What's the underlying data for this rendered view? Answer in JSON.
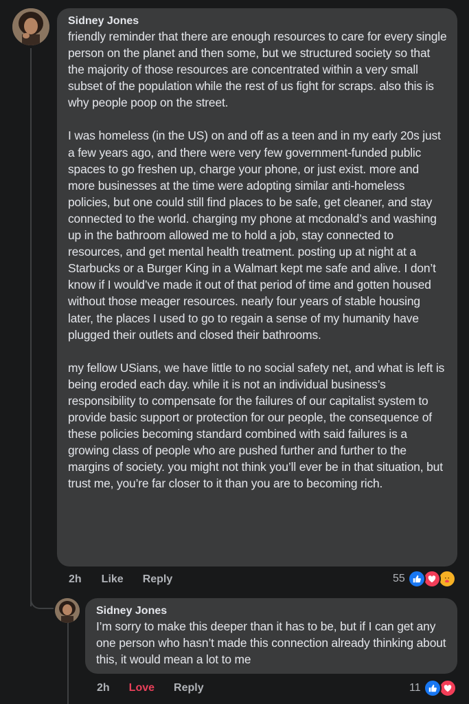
{
  "comment": {
    "author": "Sidney Jones",
    "paragraphs": [
      "friendly reminder that there are enough resources to care for every single person on the planet and then some, but we structured society so that the majority of those resources are concentrated within a very small subset of the population while the rest of us fight for scraps. also this is why people poop on the street.",
      "I was homeless (in the US) on and off as a teen and in my early 20s just a few years ago, and there were very few government-funded public spaces to go freshen up, charge your phone, or just exist. more and more businesses at the time were adopting similar anti-homeless policies, but one could still find places to be safe, get cleaner, and stay connected to the world. charging my phone at mcdonald’s and washing up in the bathroom allowed me to hold a job, stay connected to resources, and get mental health treatment. posting up at night at a Starbucks or a Burger King in a Walmart kept me safe and alive. I don’t know if I would’ve made it out of that period of time and gotten housed without those meager resources. nearly four years of stable housing later, the places I used to go to regain a sense of my humanity have plugged their outlets and closed their bathrooms.",
      "my fellow USians, we have little to no social safety net, and what is left is being eroded each day. while it is not an individual business’s responsibility to compensate for the failures of our capitalist system to provide basic support or protection for our people, the consequence of these policies becoming standard combined with said failures is a growing class of people who are pushed further and further to the margins of society. you might not think you’ll ever be in that situation, but trust me, you’re far closer to it than you are to becoming rich."
    ],
    "time": "2h",
    "like_label": "Like",
    "reply_label": "Reply",
    "reaction_count": "55",
    "reactions": [
      "like-icon",
      "love-icon",
      "care-icon"
    ]
  },
  "reply": {
    "author": "Sidney Jones",
    "text": "I’m sorry to make this deeper than it has to be, but if I can get any one person who hasn’t made this connection already thinking about this, it would mean a lot to me",
    "time": "2h",
    "like_label": "Love",
    "reply_label": "Reply",
    "reaction_count": "11",
    "reactions": [
      "like-icon",
      "love-icon"
    ]
  },
  "colors": {
    "background": "#18191a",
    "bubble": "#3a3b3c",
    "text": "#e4e6eb",
    "muted": "#b0b3b8",
    "love": "#e8405a",
    "like_blue": "#1877f2"
  }
}
